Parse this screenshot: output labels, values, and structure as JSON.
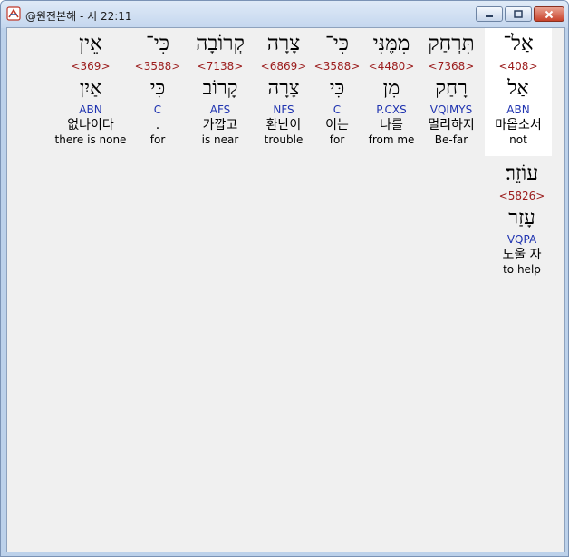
{
  "window": {
    "title": "@원전본해 - 시 22:11"
  },
  "words": [
    {
      "hebrew": "אַל־",
      "strong": "<408>",
      "lemma": "אַל",
      "parse": "ABN",
      "korean": "마옵소서",
      "english": "not"
    },
    {
      "hebrew": "תִּרְחַק",
      "strong": "<7368>",
      "lemma": "רָחַק",
      "parse": "VQIMYS",
      "korean": "멀리하지",
      "english": "Be-far"
    },
    {
      "hebrew": "מִמֶּנִּי",
      "strong": "<4480>",
      "lemma": "מִן",
      "parse": "P.CXS",
      "korean": "나를",
      "english": "from me"
    },
    {
      "hebrew": "כִּי־",
      "strong": "<3588>",
      "lemma": "כִּי",
      "parse": "C",
      "korean": "이는",
      "english": "for"
    },
    {
      "hebrew": "צָרָה",
      "strong": "<6869>",
      "lemma": "צָרָה",
      "parse": "NFS",
      "korean": "환난이",
      "english": "trouble"
    },
    {
      "hebrew": "קְרוֹבָה",
      "strong": "<7138>",
      "lemma": "קָרוֹב",
      "parse": "AFS",
      "korean": "가깝고",
      "english": "is near"
    },
    {
      "hebrew": "כִּי־",
      "strong": "<3588>",
      "lemma": "כִּי",
      "parse": "C",
      "korean": ".",
      "english": "for"
    },
    {
      "hebrew": "אֵין",
      "strong": "<369>",
      "lemma": "אַיִן",
      "parse": "ABN",
      "korean": "없나이다",
      "english": "there is none"
    },
    {
      "hebrew": "עוֹזֵר׃",
      "strong": "<5826>",
      "lemma": "עָזַר",
      "parse": "VQPA",
      "korean": "도울 자",
      "english": "to help"
    }
  ]
}
